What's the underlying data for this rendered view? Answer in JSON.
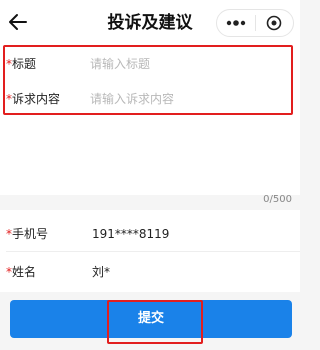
{
  "header": {
    "title": "投诉及建议",
    "back_icon": "back-arrow-icon",
    "more_icon": "more-dots-icon",
    "close_icon": "target-circle-icon"
  },
  "form": {
    "title_field": {
      "required_mark": "*",
      "label": "标题",
      "placeholder": "请输入标题",
      "value": ""
    },
    "content_field": {
      "required_mark": "*",
      "label": "诉求内容",
      "placeholder": "请输入诉求内容",
      "value": ""
    },
    "counter": "0/500"
  },
  "info": {
    "phone": {
      "required_mark": "*",
      "label": "手机号",
      "value": "191****8119"
    },
    "name": {
      "required_mark": "*",
      "label": "姓名",
      "value": "刘*"
    }
  },
  "submit": {
    "label": "提交"
  },
  "colors": {
    "accent": "#1a82e9",
    "required": "#e21e1e",
    "highlight": "#e21e1e"
  }
}
